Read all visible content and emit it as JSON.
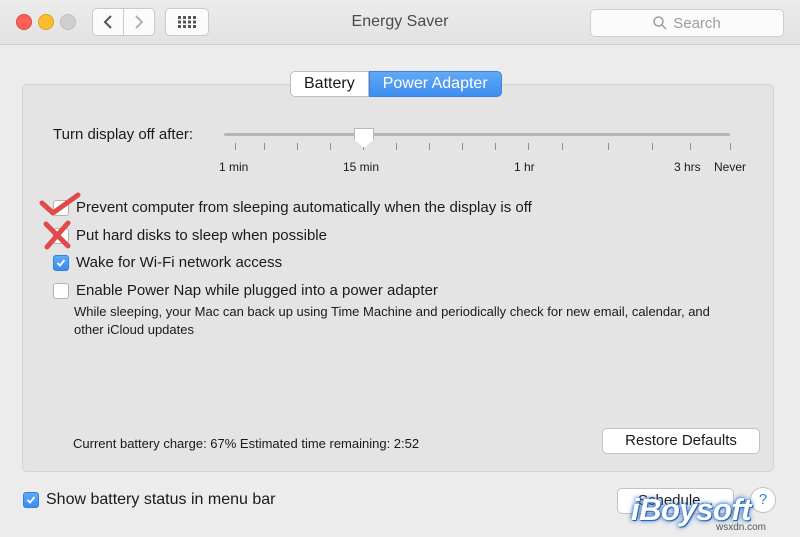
{
  "window": {
    "title": "Energy Saver",
    "search_placeholder": "Search"
  },
  "tabs": [
    {
      "label": "Battery",
      "active": false
    },
    {
      "label": "Power Adapter",
      "active": true
    }
  ],
  "display_slider": {
    "label": "Turn display off after:",
    "ticks": [
      "1 min",
      "15 min",
      "1 hr",
      "3 hrs",
      "Never"
    ],
    "selected": "15 min"
  },
  "options": [
    {
      "label": "Prevent computer from sleeping automatically when the display is off",
      "checked": false
    },
    {
      "label": "Put hard disks to sleep when possible",
      "checked": false
    },
    {
      "label": "Wake for Wi-Fi network access",
      "checked": true
    },
    {
      "label": "Enable Power Nap while plugged into a power adapter",
      "checked": false
    }
  ],
  "power_nap_description": "While sleeping, your Mac can back up using Time Machine and periodically check for new email, calendar, and other iCloud updates",
  "status": "Current battery charge: 67%  Estimated time remaining: 2:52",
  "buttons": {
    "restore_defaults": "Restore Defaults",
    "schedule": "Schedule...",
    "help": "?"
  },
  "show_battery_status": {
    "label": "Show battery status in menu bar",
    "checked": true
  },
  "colors": {
    "accent": "#3e8ef0",
    "annotation_red": "#e04a4a"
  },
  "icons": {
    "back": "chevron-left-icon",
    "forward": "chevron-right-icon",
    "grid": "grid-icon",
    "search": "search-icon"
  },
  "watermark": {
    "brand": "iBoysoft",
    "site": "wsxdn.com"
  }
}
